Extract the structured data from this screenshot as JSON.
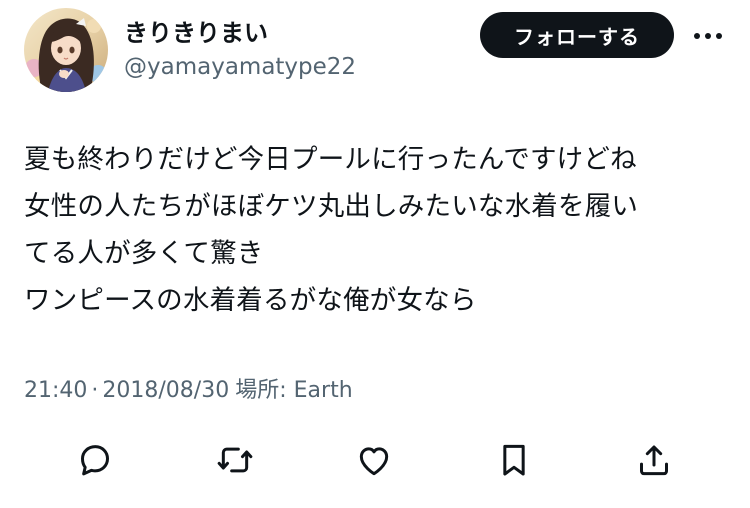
{
  "author": {
    "display_name": "きりきりまい",
    "handle": "@yamayamatype22"
  },
  "follow_button": {
    "label": "フォローする"
  },
  "tweet": {
    "lines": [
      "夏も終わりだけど今日プールに行ったんですけどね",
      "女性の人たちがほぼケツ丸出しみたいな水着を履い",
      "てる人が多くて驚き",
      "ワンピースの水着着るがな俺が女なら"
    ]
  },
  "meta": {
    "time": "21:40",
    "separator": "·",
    "date": "2018/08/30",
    "location_label": "場所:",
    "location": "Earth"
  },
  "actions": {
    "reply_icon": "speech-bubble-icon",
    "retweet_icon": "retweet-arrows-icon",
    "like_icon": "heart-icon",
    "bookmark_icon": "bookmark-icon",
    "share_icon": "share-upload-icon"
  },
  "colors": {
    "text_primary": "#0f1419",
    "text_secondary": "#536471",
    "button_bg": "#0f1419",
    "button_text": "#ffffff"
  }
}
